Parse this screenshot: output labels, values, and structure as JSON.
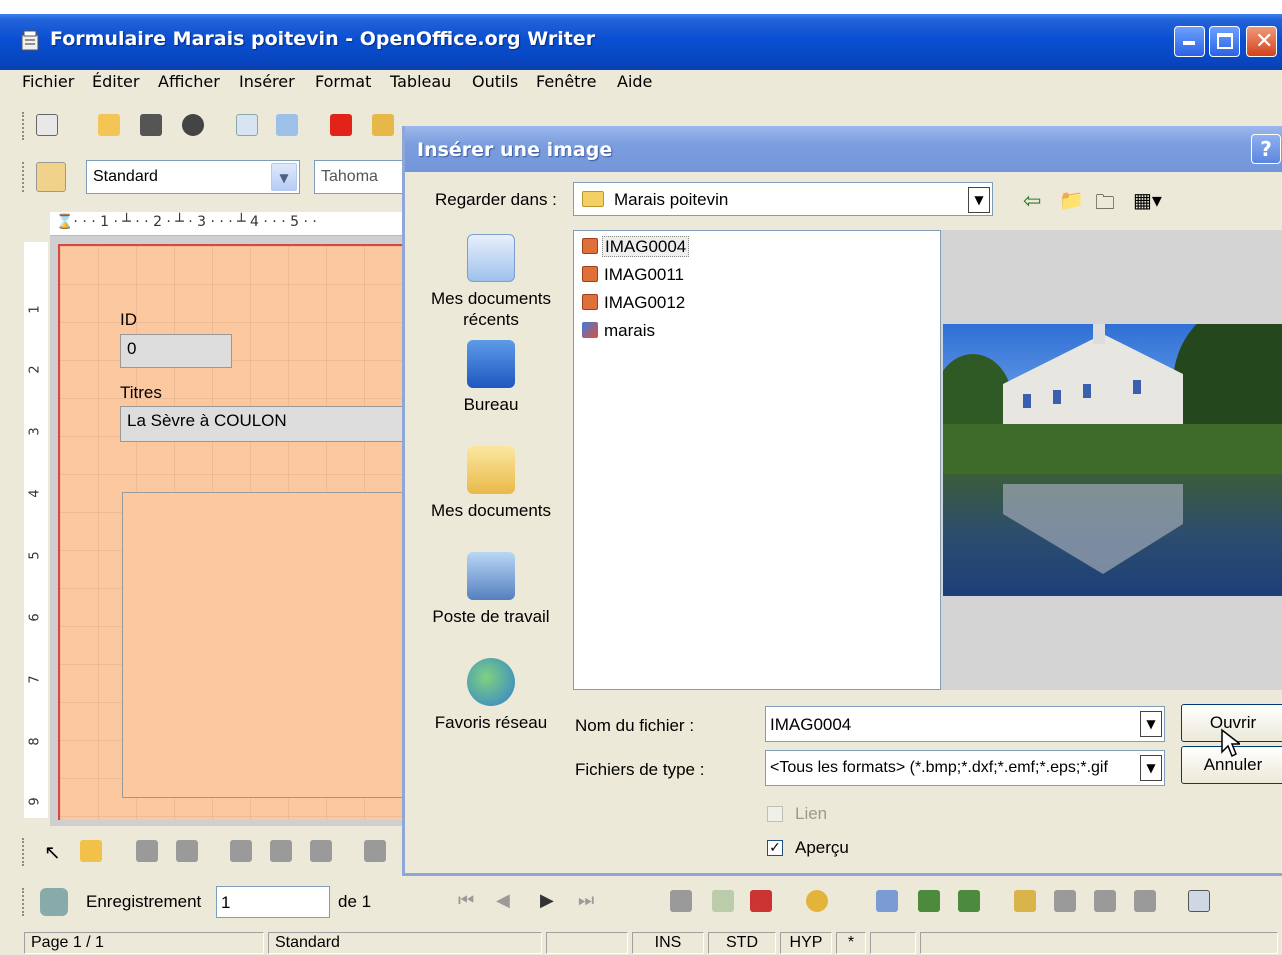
{
  "window": {
    "title": "Formulaire Marais poitevin - OpenOffice.org Writer"
  },
  "menu": {
    "items": [
      "Fichier",
      "Éditer",
      "Afficher",
      "Insérer",
      "Format",
      "Tableau",
      "Outils",
      "Fenêtre",
      "Aide"
    ]
  },
  "formatting": {
    "style": "Standard",
    "font": "Tahoma"
  },
  "ruler": {
    "marks": "⌛· · · 1 · ┴ · · 2 · ┴ · 3 · · · ┴ 4 · · · 5 · ·"
  },
  "form": {
    "id_label": "ID",
    "id_value": "0",
    "title_label": "Titres",
    "title_value": "La Sèvre à COULON"
  },
  "navigation": {
    "record_label": "Enregistrement",
    "record_value": "1",
    "of_label": "de 1"
  },
  "status": {
    "page": "Page 1 / 1",
    "style": "Standard",
    "ins": "INS",
    "std": "STD",
    "hyp": "HYP",
    "modified": "*"
  },
  "dialog": {
    "title": "Insérer une image",
    "help": "?",
    "look_in_label": "Regarder dans :",
    "look_in_value": "Marais poitevin",
    "places": [
      {
        "label": "Mes documents récents",
        "icon": "recent-documents-icon"
      },
      {
        "label": "Bureau",
        "icon": "desktop-icon"
      },
      {
        "label": "Mes documents",
        "icon": "my-documents-icon"
      },
      {
        "label": "Poste de travail",
        "icon": "my-computer-icon"
      },
      {
        "label": "Favoris réseau",
        "icon": "network-places-icon"
      }
    ],
    "files": [
      {
        "name": "IMAG0004",
        "selected": true
      },
      {
        "name": "IMAG0011",
        "selected": false
      },
      {
        "name": "IMAG0012",
        "selected": false
      },
      {
        "name": "marais",
        "selected": false
      }
    ],
    "filename_label": "Nom du fichier :",
    "filename_value": "IMAG0004",
    "filetype_label": "Fichiers de type :",
    "filetype_value": "<Tous les formats> (*.bmp;*.dxf;*.emf;*.eps;*.gif",
    "open_button": "Ouvrir",
    "cancel_button": "Annuler",
    "link_label": "Lien",
    "link_checked": false,
    "preview_label": "Aperçu",
    "preview_checked": true
  },
  "colors": {
    "titlebar": "#0a4fd2",
    "dialog_titlebar": "#7a9ede",
    "form_background": "#fcc89f",
    "form_border": "#dd4444"
  }
}
